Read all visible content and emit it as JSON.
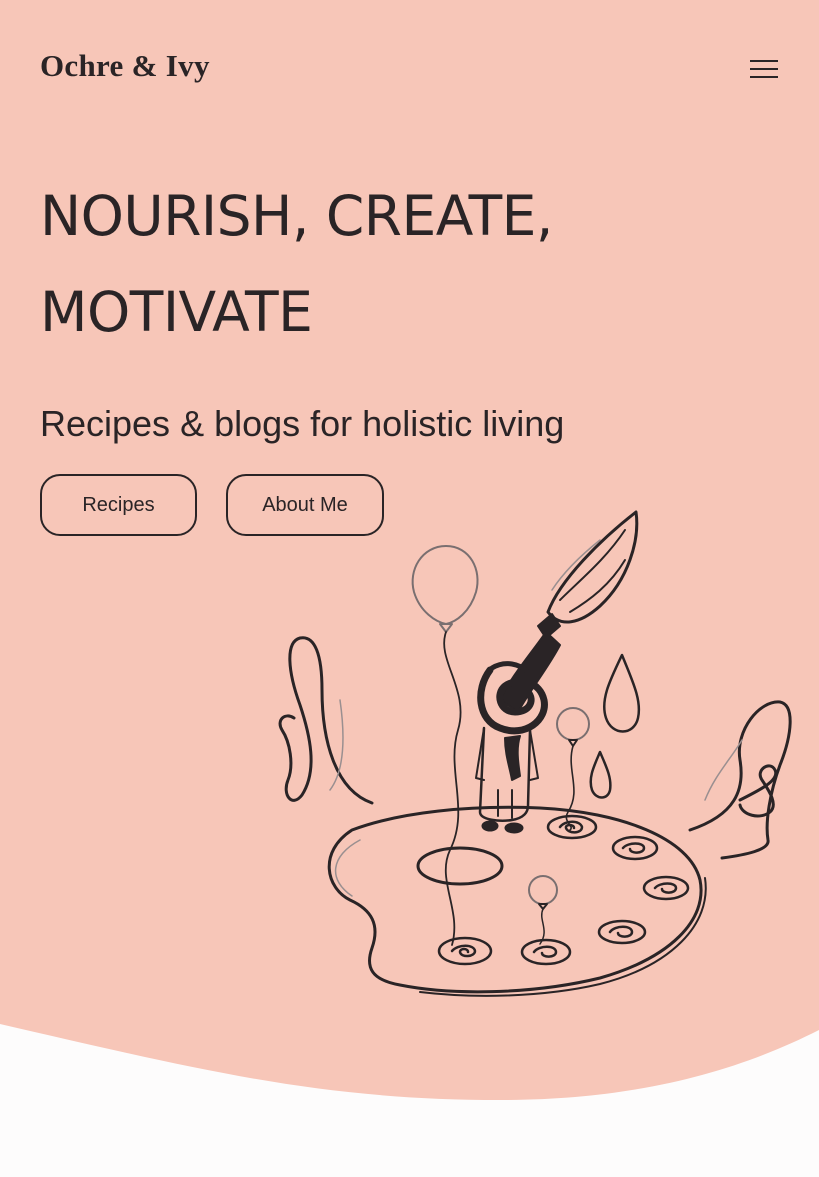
{
  "brand": {
    "name": "Ochre & Ivy"
  },
  "nav": {
    "menu_icon": "hamburger-menu-icon"
  },
  "hero": {
    "headline_line1": "NOURISH, CREATE,",
    "headline_line2": "MOTIVATE",
    "subtitle": "Recipes & blogs for holistic living",
    "buttons": [
      {
        "label": "Recipes"
      },
      {
        "label": "About Me"
      }
    ],
    "illustration": "paintbrush-palette-balloons-illustration"
  },
  "colors": {
    "hero_background": "#f7c6b8",
    "page_background": "#fdfcfc",
    "ink": "#2a2426"
  }
}
